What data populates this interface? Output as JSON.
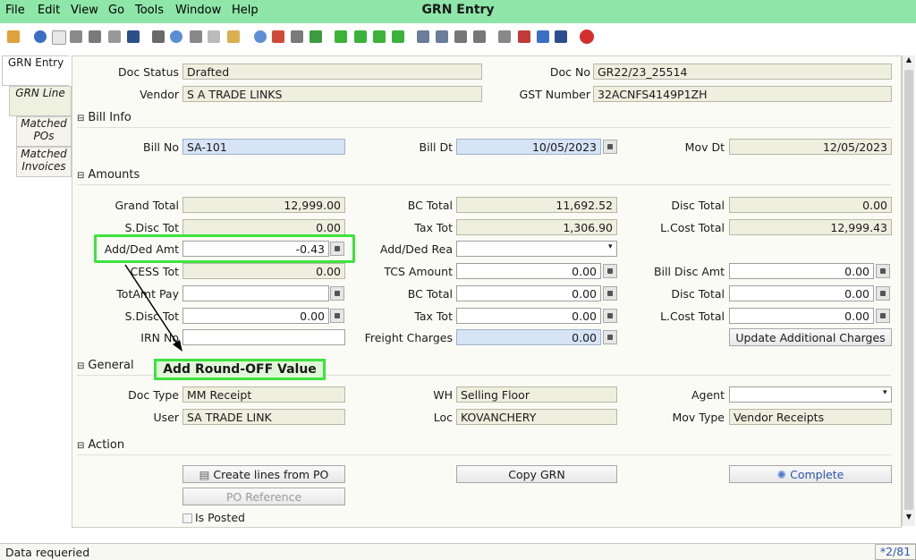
{
  "menu": {
    "items": [
      "File",
      "Edit",
      "View",
      "Go",
      "Tools",
      "Window",
      "Help"
    ],
    "window_title": "GRN Entry"
  },
  "tabs": {
    "grn_entry": "GRN Entry",
    "grn_line": "GRN Line",
    "matched_pos": "Matched POs",
    "matched_invoices": "Matched Invoices"
  },
  "header": {
    "doc_status_label": "Doc Status",
    "doc_status": "Drafted",
    "doc_no_label": "Doc No",
    "doc_no": "GR22/23_25514",
    "vendor_label": "Vendor",
    "vendor": "S A TRADE LINKS",
    "gst_label": "GST Number",
    "gst": "32ACNFS4149P1ZH"
  },
  "bill_info": {
    "section": "Bill Info",
    "bill_no_label": "Bill No",
    "bill_no": "SA-101",
    "bill_dt_label": "Bill Dt",
    "bill_dt": "10/05/2023",
    "mov_dt_label": "Mov Dt",
    "mov_dt": "12/05/2023"
  },
  "amounts": {
    "section": "Amounts",
    "grand_total_label": "Grand Total",
    "grand_total": "12,999.00",
    "bc_total_label": "BC Total",
    "bc_total": "11,692.52",
    "disc_total_label": "Disc Total",
    "disc_total": "0.00",
    "sdisc_tot_label": "S.Disc Tot",
    "sdisc_tot": "0.00",
    "tax_tot_label": "Tax Tot",
    "tax_tot": "1,306.90",
    "lcost_total_label": "L.Cost Total",
    "lcost_total": "12,999.43",
    "add_ded_amt_label": "Add/Ded Amt",
    "add_ded_amt": "-0.43",
    "add_ded_rea_label": "Add/Ded Rea",
    "cess_tot_label": "CESS Tot",
    "cess_tot": "0.00",
    "tcs_amount_label": "TCS Amount",
    "tcs_amount": "0.00",
    "bill_disc_amt_label": "Bill Disc Amt",
    "bill_disc_amt": "0.00",
    "totamt_pay_label": "TotAmt Pay",
    "bc_total2_label": "BC Total",
    "bc_total2": "0.00",
    "disc_total2_label": "Disc Total",
    "disc_total2": "0.00",
    "sdisc_tot2_label": "S.Disc Tot",
    "sdisc_tot2": "0.00",
    "tax_tot2_label": "Tax Tot",
    "tax_tot2": "0.00",
    "lcost_total2_label": "L.Cost Total",
    "lcost_total2": "0.00",
    "irn_no_label": "IRN No",
    "freight_label": "Freight Charges",
    "freight": "0.00",
    "update_btn": "Update Additional Charges"
  },
  "callout": "Add Round-OFF Value",
  "general": {
    "section": "General",
    "doc_type_label": "Doc Type",
    "doc_type": "MM Receipt",
    "wh_label": "WH",
    "wh": "Selling Floor",
    "agent_label": "Agent",
    "user_label": "User",
    "user": "SA TRADE LINK",
    "loc_label": "Loc",
    "loc": "KOVANCHERY",
    "mov_type_label": "Mov Type",
    "mov_type": "Vendor Receipts"
  },
  "action": {
    "section": "Action",
    "create_lines": "Create lines from PO",
    "copy_grn": "Copy GRN",
    "complete": "Complete",
    "po_reference": "PO Reference",
    "is_posted": "Is Posted"
  },
  "status": {
    "message": "Data requeried",
    "record": "*2/81"
  },
  "colors": {
    "menubar": "#8ee6a8",
    "highlight": "#3de33d",
    "input_blue": "#d6e4f5"
  }
}
